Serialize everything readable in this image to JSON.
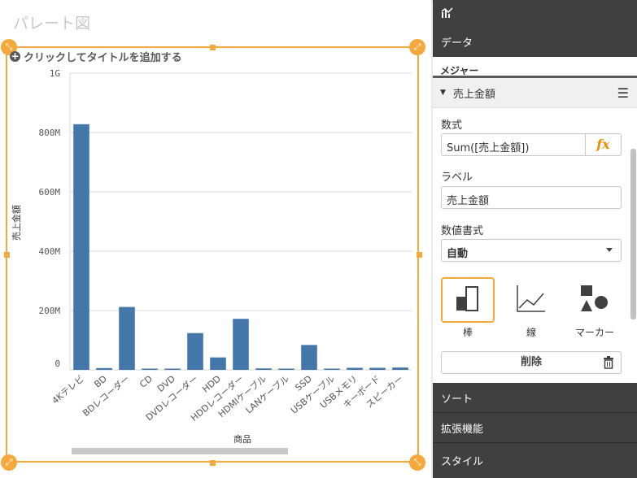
{
  "sheet": {
    "title": "パレート図",
    "add_title": "クリックしてタイトルを追加する"
  },
  "chart_data": {
    "type": "bar",
    "categories": [
      "4Kテレビ",
      "BD",
      "BDレコーダー",
      "CD",
      "DVD",
      "DVDレコーダー",
      "HDD",
      "HDDレコーダー",
      "HDMIケーブル",
      "LANケーブル",
      "SSD",
      "USBケーブル",
      "USBメモリ",
      "キーボード",
      "スピーカー"
    ],
    "values": [
      828000000,
      6000000,
      212000000,
      2000000,
      4000000,
      124000000,
      42000000,
      172000000,
      5000000,
      4000000,
      84000000,
      3000000,
      7000000,
      7000000,
      8000000
    ],
    "xlabel": "商品",
    "ylabel": "売上金額",
    "ylim": [
      0,
      1000000000
    ],
    "yticks": [
      0,
      200000000,
      400000000,
      600000000,
      800000000,
      1000000000
    ],
    "ytick_labels": [
      "0",
      "200M",
      "400M",
      "600M",
      "800M",
      "1G"
    ],
    "bar_color": "#4477aa",
    "grid": true
  },
  "panel": {
    "sections": {
      "data": "データ",
      "sort": "ソート",
      "addons": "拡張機能",
      "style": "スタイル"
    },
    "measure_header": "メジャー",
    "measure_name": "売上金額",
    "expression_label": "数式",
    "expression_value": "Sum([売上金額])",
    "fx_label": "fx",
    "label_label": "ラベル",
    "label_value": "売上金額",
    "format_label": "数値書式",
    "format_value": "自動",
    "chart_types": [
      {
        "label": "棒",
        "icon": "bar-chart-icon",
        "selected": true
      },
      {
        "label": "線",
        "icon": "line-chart-icon",
        "selected": false
      },
      {
        "label": "マーカー",
        "icon": "marker-icon",
        "selected": false
      }
    ],
    "delete_label": "削除"
  },
  "colors": {
    "accent": "#f5a83c",
    "dark_panel": "#404040",
    "fx": "#f08c00"
  }
}
